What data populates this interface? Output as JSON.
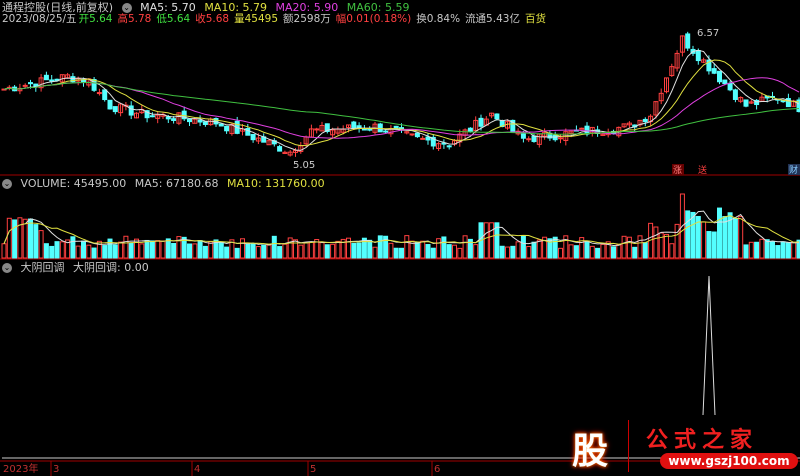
{
  "header": {
    "title": "通程控股(日线,前复权)",
    "ma5": "MA5: 5.70",
    "ma10": "MA10: 5.79",
    "ma20": "MA20: 5.90",
    "ma60": "MA60: 5.59"
  },
  "quote": {
    "date": "2023/08/25/五",
    "open_l": "开",
    "open": "5.64",
    "high_l": "高",
    "high": "5.78",
    "low_l": "低",
    "low": "5.64",
    "close_l": "收",
    "close": "5.68",
    "vol_l": "量",
    "vol": "45495",
    "amt": "额2598万",
    "chg_l": "幅",
    "chg": "0.01(0.18%)",
    "turn": "换0.84%",
    "float": "流通5.43亿",
    "sector": "百货"
  },
  "price_marks": {
    "high": "6.57",
    "low": "5.05"
  },
  "event_marks": [
    "涨",
    "送",
    "财"
  ],
  "volume": {
    "label": "VOLUME: 45495.00",
    "ma5": "MA5: 67180.68",
    "ma10": "MA10: 131760.00"
  },
  "indicator": {
    "name": "大阴回调",
    "value": "大阴回调: 0.00"
  },
  "axis": {
    "year": "2023年",
    "months": [
      "3",
      "4",
      "5",
      "6"
    ]
  },
  "watermark": {
    "logo": "股",
    "name": "公式之家",
    "url": "www.gszj100.com"
  },
  "colors": {
    "up": "#ff4040",
    "down": "#54ffff",
    "ma5": "#e0e0e0",
    "ma10": "#e0e040",
    "ma20": "#e040e0",
    "ma60": "#40c040",
    "frame": "#a00000"
  },
  "chart_data": {
    "type": "candlestick",
    "price_range": [
      5.05,
      6.57
    ],
    "close_keypoints": [
      [
        0,
        5.9
      ],
      [
        12,
        6.05
      ],
      [
        16,
        6.0
      ],
      [
        20,
        5.7
      ],
      [
        26,
        5.6
      ],
      [
        34,
        5.55
      ],
      [
        40,
        5.5
      ],
      [
        48,
        5.3
      ],
      [
        54,
        5.15
      ],
      [
        58,
        5.4
      ],
      [
        70,
        5.45
      ],
      [
        78,
        5.3
      ],
      [
        84,
        5.25
      ],
      [
        92,
        5.6
      ],
      [
        98,
        5.3
      ],
      [
        104,
        5.35
      ],
      [
        118,
        5.45
      ],
      [
        122,
        5.6
      ],
      [
        128,
        6.5
      ],
      [
        134,
        6.1
      ],
      [
        140,
        5.7
      ],
      [
        146,
        5.8
      ],
      [
        150,
        5.68
      ]
    ]
  }
}
